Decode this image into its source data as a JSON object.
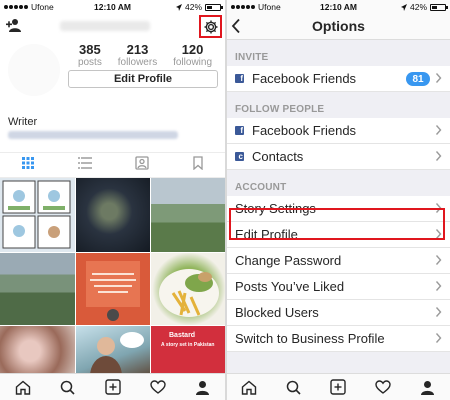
{
  "status": {
    "carrier": "Ufone",
    "time": "12:10 AM",
    "battery": "42%"
  },
  "profile": {
    "stats": [
      {
        "value": "385",
        "label": "posts"
      },
      {
        "value": "213",
        "label": "followers"
      },
      {
        "value": "120",
        "label": "following"
      }
    ],
    "edit_label": "Edit Profile",
    "bio": "Writer",
    "tile_text": {
      "bastard": "Bastard",
      "bastard_sub": "A story set in Pakistan"
    }
  },
  "options": {
    "title": "Options",
    "sections": [
      {
        "header": "INVITE",
        "rows": [
          {
            "label": "Facebook Friends",
            "badge": "81",
            "fb": true
          }
        ]
      },
      {
        "header": "FOLLOW PEOPLE",
        "rows": [
          {
            "label": "Facebook Friends",
            "fb": true
          },
          {
            "label": "Contacts",
            "fb": true
          }
        ]
      },
      {
        "header": "ACCOUNT",
        "rows": [
          {
            "label": "Story Settings"
          },
          {
            "label": "Edit Profile"
          },
          {
            "label": "Change Password"
          },
          {
            "label": "Posts You’ve Liked"
          },
          {
            "label": "Blocked Users"
          },
          {
            "label": "Switch to Business Profile"
          }
        ]
      }
    ]
  },
  "colors": {
    "highlight": "#e0161e",
    "badge": "#3897f0",
    "facebook": "#3b5998"
  },
  "icons": [
    "add-user-icon",
    "gear-icon",
    "grid-icon",
    "list-icon",
    "tagged-icon",
    "bookmark-icon",
    "home-icon",
    "search-icon",
    "add-post-icon",
    "heart-icon",
    "profile-icon",
    "back-icon",
    "chevron-right-icon",
    "facebook-icon"
  ]
}
